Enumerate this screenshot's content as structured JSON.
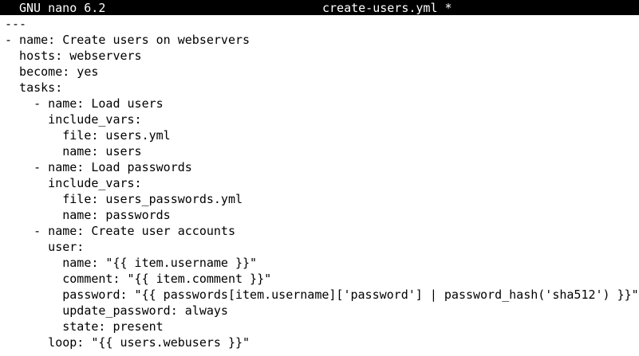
{
  "titlebar": {
    "app_label": "GNU nano 6.2",
    "filename_label": "create-users.yml *"
  },
  "lines": [
    "---",
    "- name: Create users on webservers",
    "  hosts: webservers",
    "  become: yes",
    "  tasks:",
    "    - name: Load users",
    "      include_vars:",
    "        file: users.yml",
    "        name: users",
    "    - name: Load passwords",
    "      include_vars:",
    "        file: users_passwords.yml",
    "        name: passwords",
    "    - name: Create user accounts",
    "      user:",
    "        name: \"{{ item.username }}\"",
    "        comment: \"{{ item.comment }}\"",
    "        password: \"{{ passwords[item.username]['password'] | password_hash('sha512') }}\"",
    "        update_password: always",
    "        state: present",
    "      loop: \"{{ users.webusers }}\""
  ]
}
